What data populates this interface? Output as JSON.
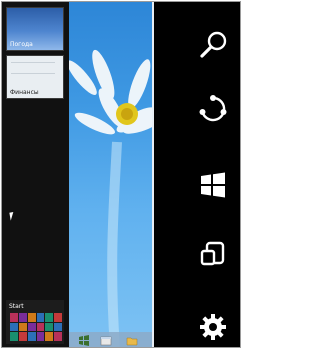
{
  "switcher": {
    "apps": [
      {
        "label": "Погода"
      },
      {
        "label": "Финансы"
      }
    ],
    "start_label": "Start",
    "tile_colors": [
      "#b8315a",
      "#7a2d9a",
      "#cf7a1a",
      "#2c6fb8",
      "#1a8f6f",
      "#c43a3a",
      "#2c6fb8",
      "#cf7a1a",
      "#7a2d9a",
      "#b8315a",
      "#1a8f6f",
      "#2c6fb8",
      "#1a8f6f",
      "#c43a3a",
      "#2c6fb8",
      "#7a2d9a",
      "#cf7a1a",
      "#b8315a"
    ]
  },
  "desktop": {
    "wallpaper_colors": [
      "#2d86d7",
      "#7ec3f4"
    ],
    "taskbar_icons": [
      "store-icon",
      "file-explorer-icon",
      "folder-icon"
    ]
  },
  "charms": [
    {
      "name": "search-icon"
    },
    {
      "name": "share-icon"
    },
    {
      "name": "start-icon"
    },
    {
      "name": "devices-icon"
    },
    {
      "name": "settings-icon"
    }
  ]
}
